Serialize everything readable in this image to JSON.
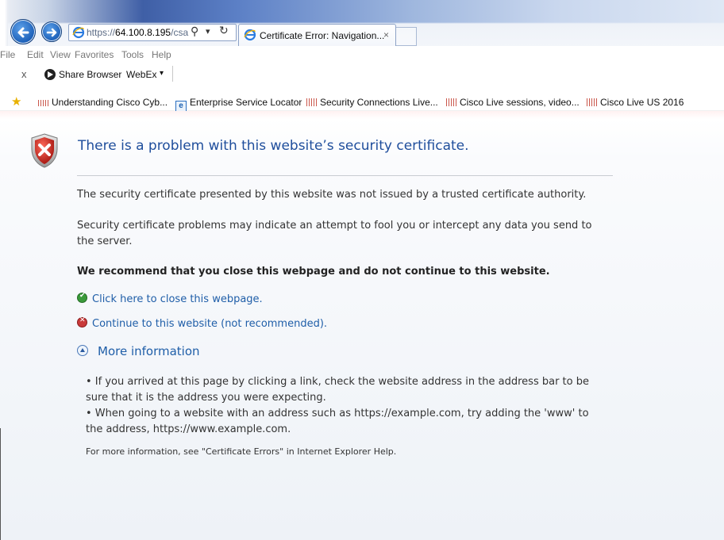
{
  "browser": {
    "url_prefix": "https://",
    "url_host": "64.100.8.195",
    "url_tail": "/csa",
    "tab_title": "Certificate Error: Navigation...",
    "tab_close": "×"
  },
  "menu": {
    "items": [
      "File",
      "Edit",
      "View",
      "Favorites",
      "Tools",
      "Help"
    ]
  },
  "command_bar": {
    "close_label": "x",
    "share_label": "Share Browser",
    "webex_label": "WebEx",
    "webex_caret": "▾"
  },
  "favorites": {
    "items": [
      "Understanding Cisco Cyb...",
      "Enterprise Service Locator",
      "Security Connections Live...",
      "Cisco Live sessions, video...",
      "Cisco Live US 2016"
    ]
  },
  "page": {
    "heading": "There is a problem with this website’s security certificate.",
    "para1": "The security certificate presented by this website was not issued by a trusted certificate authority.",
    "para2": "Security certificate problems may indicate an attempt to fool you or intercept any data you send to the server.",
    "recommend": "We recommend that you close this webpage and do not continue to this website.",
    "close_link": "Click here to close this webpage.",
    "continue_link": "Continue to this website (not recommended).",
    "more_info": "More information",
    "bullet1": "•  If you arrived at this page by clicking a link, check the website address in the address bar to be sure that it is the address you were expecting.",
    "bullet2": "•  When going to a website with an address such as https://example.com, try adding the 'www' to the address, https://www.example.com.",
    "help_note": "For more information, see \"Certificate Errors\" in Internet Explorer Help."
  },
  "colors": {
    "link": "#1f5ea8",
    "heading": "#1f4e9c",
    "shield_red": "#c0392b"
  }
}
